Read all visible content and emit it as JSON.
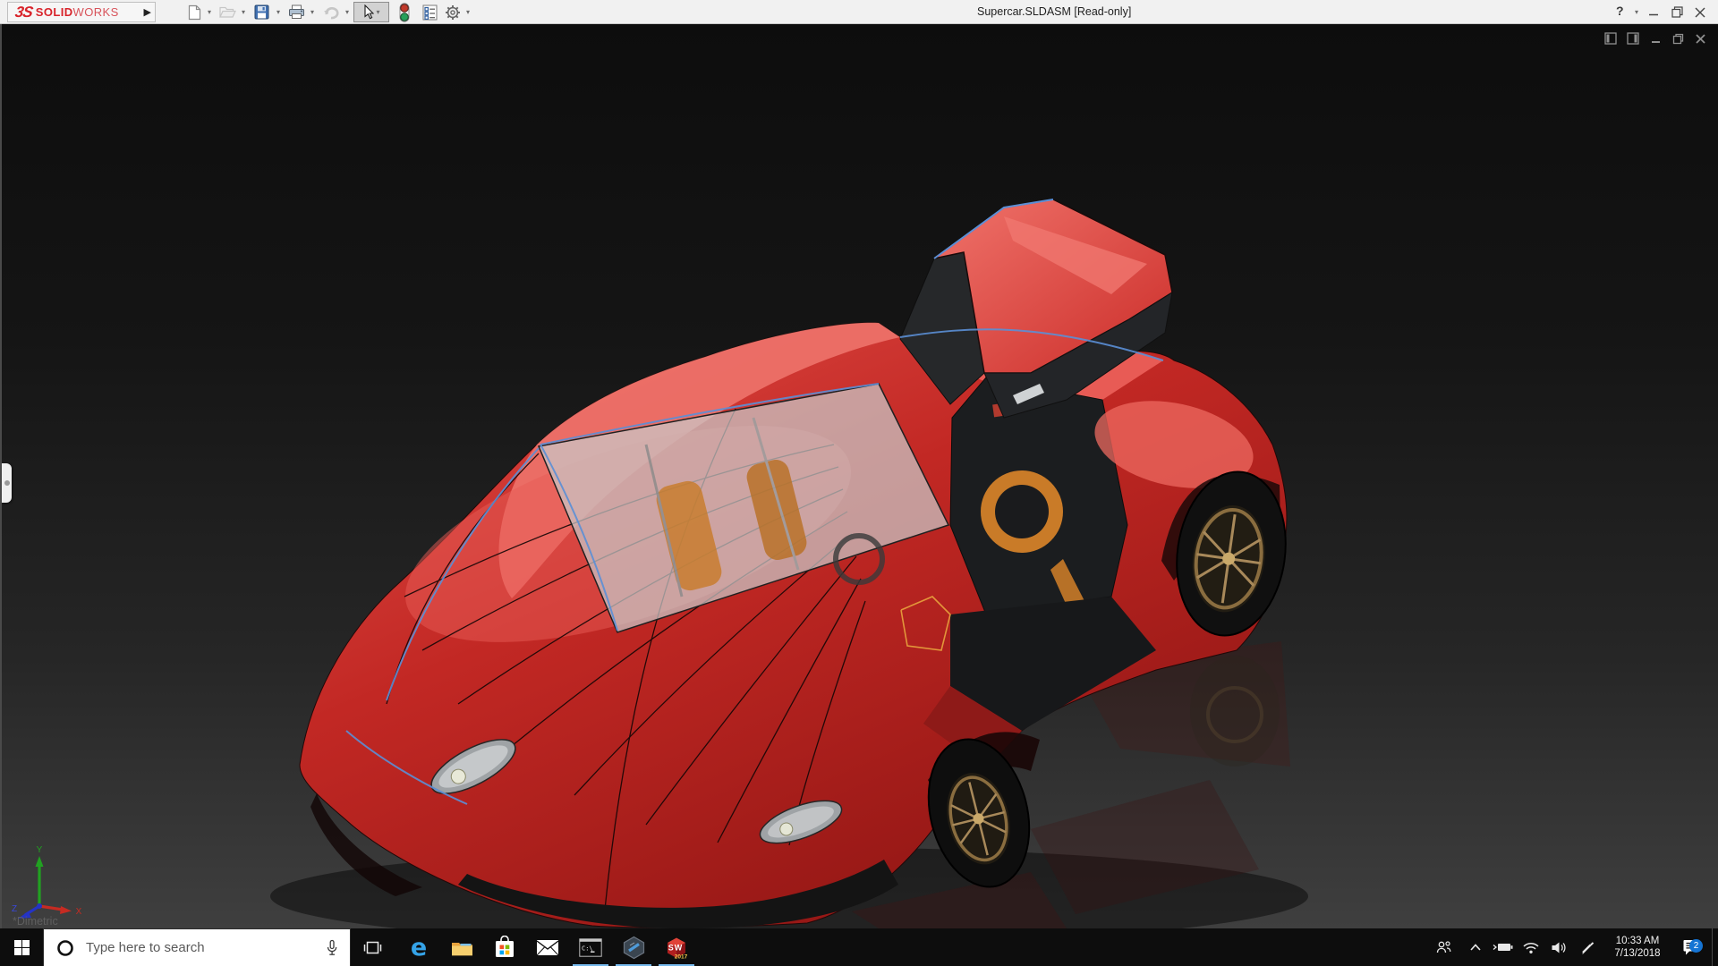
{
  "window": {
    "title": "Supercar.SLDASM [Read-only]",
    "help_glyph": "?"
  },
  "brand": {
    "mark": "3S",
    "bold": "SOLID",
    "light": "WORKS",
    "color": "#d8232a"
  },
  "toolbar": {
    "flyout_glyph": "▶",
    "dropdown_glyph": "▾",
    "items": [
      {
        "name": "new-document",
        "enabled": true
      },
      {
        "name": "open",
        "enabled": false
      },
      {
        "name": "save",
        "enabled": true
      },
      {
        "name": "print",
        "enabled": true
      },
      {
        "name": "undo",
        "enabled": false
      },
      {
        "name": "select",
        "enabled": true,
        "active": true
      },
      {
        "name": "rebuild-traffic-light",
        "enabled": true
      },
      {
        "name": "file-properties",
        "enabled": true
      },
      {
        "name": "options-gear",
        "enabled": true
      }
    ]
  },
  "viewport": {
    "orientation_label": "*Dimetric",
    "triad_labels": {
      "x": "X",
      "y": "Y",
      "z": "Z"
    },
    "background_top": "#0d0d0d",
    "background_bottom": "#3f3f3f"
  },
  "model": {
    "name": "Supercar",
    "body_color": "#c92a28",
    "highlight_color": "#f0776f",
    "seat_color": "#c97b28",
    "rim_color": "#a8895a",
    "edge_accent_color": "#5b8fd6"
  },
  "taskbar": {
    "search": {
      "placeholder": "Type here to search"
    },
    "underline_color": "#76b9ed",
    "apps": [
      {
        "name": "start"
      },
      {
        "name": "task-view"
      },
      {
        "name": "edge",
        "glyph": "e"
      },
      {
        "name": "file-explorer"
      },
      {
        "name": "store"
      },
      {
        "name": "mail"
      },
      {
        "name": "command-prompt",
        "label": "C:\\",
        "running": true
      },
      {
        "name": "hexagon-app",
        "running": true
      },
      {
        "name": "solidworks-2017",
        "label_top": "SW",
        "label_year": "2017",
        "running": true
      }
    ]
  },
  "tray": {
    "time": "10:33 AM",
    "date": "7/13/2018",
    "notification_count": "2",
    "icons": [
      "people",
      "hidden-icons-chevron",
      "battery-charging",
      "wifi",
      "volume",
      "windows-ink",
      "action-center"
    ]
  }
}
